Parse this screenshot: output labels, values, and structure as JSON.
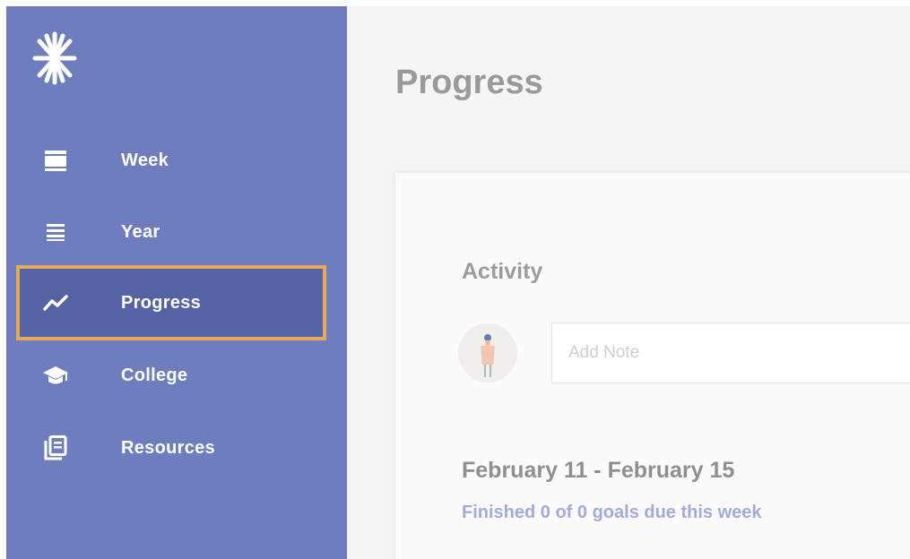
{
  "sidebar": {
    "logo_icon": "asterisk-logo-icon",
    "items": [
      {
        "label": "Week",
        "icon": "week-icon",
        "active": false
      },
      {
        "label": "Year",
        "icon": "list-icon",
        "active": false
      },
      {
        "label": "Progress",
        "icon": "trend-line-icon",
        "active": true
      },
      {
        "label": "College",
        "icon": "graduation-cap-icon",
        "active": false
      },
      {
        "label": "Resources",
        "icon": "document-stack-icon",
        "active": false
      }
    ]
  },
  "main": {
    "title": "Progress",
    "activity": {
      "title": "Activity",
      "note_placeholder": "Add Note"
    },
    "week": {
      "range": "February 11 - February 15",
      "summary": "Finished 0 of 0 goals due this week"
    }
  },
  "colors": {
    "sidebar_bg": "#6e7dbd",
    "active_bg": "#5563a3",
    "active_border": "#e6a85e",
    "accent_text": "#a3acd8"
  }
}
